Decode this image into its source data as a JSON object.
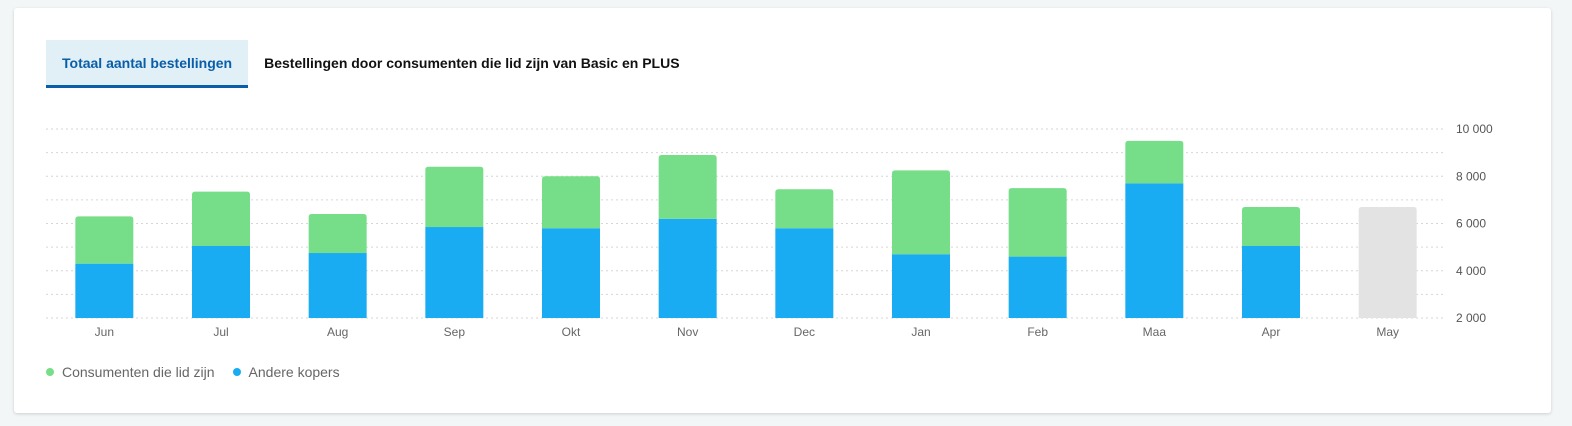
{
  "tabs": [
    {
      "label": "Totaal aantal bestellingen",
      "active": true
    },
    {
      "label": "Bestellingen door consumenten die lid zijn van Basic en PLUS",
      "active": false
    }
  ],
  "colors": {
    "members": "#76de89",
    "others": "#19acf2",
    "forecast": "#e3e3e3",
    "active_tab": "#0a5ea8"
  },
  "legend": [
    {
      "label": "Consumenten die lid zijn",
      "color": "#76de89"
    },
    {
      "label": "Andere kopers",
      "color": "#19acf2"
    }
  ],
  "chart_data": {
    "type": "bar",
    "stacked": true,
    "categories": [
      "Jun",
      "Jul",
      "Aug",
      "Sep",
      "Okt",
      "Nov",
      "Dec",
      "Jan",
      "Feb",
      "Maa",
      "Apr",
      "May"
    ],
    "series": [
      {
        "name": "Andere kopers",
        "values": [
          4300,
          5050,
          4750,
          5850,
          5800,
          6200,
          5800,
          4700,
          4600,
          7700,
          5050,
          0
        ]
      },
      {
        "name": "Consumenten die lid zijn",
        "values": [
          2000,
          2300,
          1650,
          2550,
          2200,
          2700,
          1650,
          3550,
          2900,
          1800,
          1650,
          0
        ]
      }
    ],
    "incomplete": {
      "category": "May",
      "total": 6700
    },
    "y_ticks": [
      "2 000",
      "4 000",
      "6 000",
      "8 000",
      "10 000"
    ],
    "ylim": [
      2000,
      10000
    ],
    "y_axis_position": "right",
    "grid": true,
    "legend_position": "bottom-left"
  }
}
